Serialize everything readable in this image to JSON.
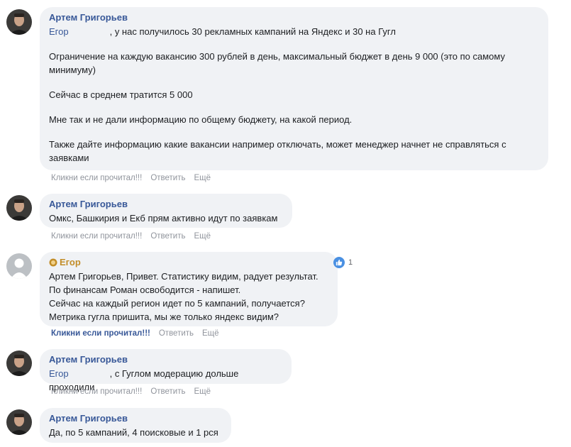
{
  "comments": [
    {
      "author": "Артем Григорьев",
      "mention": "Егор",
      "first_line_rest": ", у нас получилось 30 рекламных кампаний на Яндекс и 30 на Гугл",
      "paragraphs": [
        "Ограничение на каждую вакансию 300 рублей в день, максимальный бюджет в день 9 000 (это по самому минимуму)",
        "Сейчас в среднем тратится 5 000",
        "Мне так и не дали информацию по общему бюджету, на какой период.",
        "Также дайте информацию какие вакансии например отключать, может менеджер начнет не справляться с заявками"
      ],
      "actions": [
        "Кликни если прочитал!!!",
        "Ответить",
        "Ещё"
      ]
    },
    {
      "author": "Артем Григорьев",
      "lines": [
        "Омкс, Башкирия и Екб прям активно идут по заявкам"
      ],
      "actions": [
        "Кликни если прочитал!!!",
        "Ответить",
        "Ещё"
      ]
    },
    {
      "author": "Егор",
      "lines": [
        "Артем Григорьев, Привет. Статистику видим, радует результат.",
        "По финансам Роман освободится - напишет.",
        "Сейчас на каждый регион идет по 5 кампаний, получается?",
        "Метрика гугла пришита, мы же только яндекс видим?"
      ],
      "reaction_count": "1",
      "actions": [
        "Кликни если прочитал!!!",
        "Ответить",
        "Ещё"
      ]
    },
    {
      "author": "Артем Григорьев",
      "mention": "Егор",
      "first_line_rest": ", с Гуглом модерацию дольше проходили",
      "actions": [
        "Кликни если прочитал!!!",
        "Ответить",
        "Ещё"
      ]
    },
    {
      "author": "Артем Григорьев",
      "lines": [
        "Да, по 5 кампаний, 4 поисковые и 1 рся"
      ]
    }
  ],
  "colors": {
    "bubble": "#f0f2f5",
    "author_link": "#385898",
    "author_gold": "#c28d28",
    "action_gray": "#90949c",
    "like_blue": "#4a90e2"
  }
}
